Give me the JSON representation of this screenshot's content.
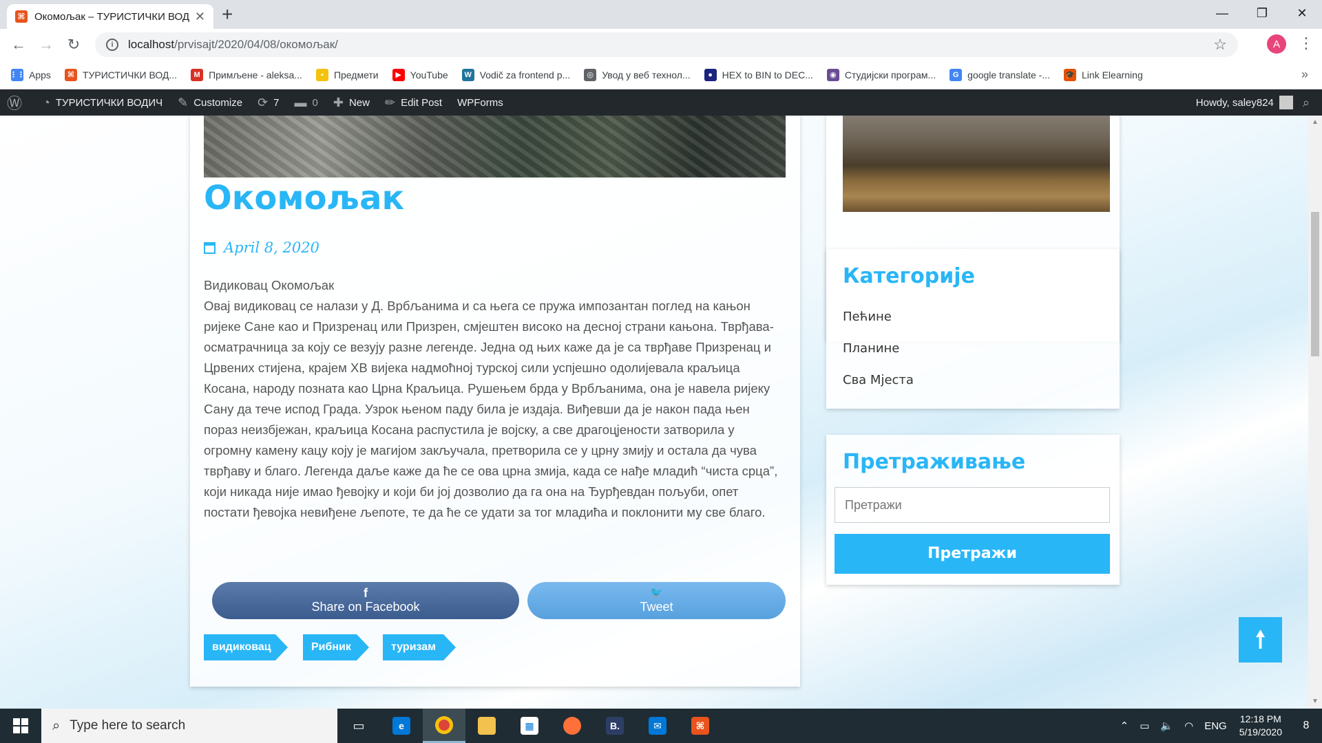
{
  "browser": {
    "tab_title": "Окомољак – ТУРИСТИЧКИ ВОДИ",
    "tab_favicon": "⌘",
    "url_host": "localhost",
    "url_path": "/prvisajt/2020/04/08/окомољак/",
    "profile_initial": "A"
  },
  "bookmarks": [
    {
      "label": "Apps",
      "color": "#4285f4",
      "glyph": "⋮⋮"
    },
    {
      "label": "ТУРИСТИЧКИ ВОД...",
      "color": "#e8531e",
      "glyph": "⌘"
    },
    {
      "label": "Примљене - aleksa...",
      "color": "#d93025",
      "glyph": "M"
    },
    {
      "label": "Предмети",
      "color": "#f4c20d",
      "glyph": "▪"
    },
    {
      "label": "YouTube",
      "color": "#ff0000",
      "glyph": "▶"
    },
    {
      "label": "Vodič za frontend p...",
      "color": "#21759b",
      "glyph": "W"
    },
    {
      "label": "Увод у веб технол...",
      "color": "#5f6368",
      "glyph": "◎"
    },
    {
      "label": "HEX to BIN to DEC...",
      "color": "#1a237e",
      "glyph": "●"
    },
    {
      "label": "Студијски програм...",
      "color": "#6a4c93",
      "glyph": "◉"
    },
    {
      "label": "google translate -...",
      "color": "#4285f4",
      "glyph": "G"
    },
    {
      "label": "Link Elearning",
      "color": "#e65100",
      "glyph": "🎓"
    }
  ],
  "admin_bar": {
    "site_name": "ТУРИСТИЧКИ ВОДИЧ",
    "customize": "Customize",
    "updates": "7",
    "comments": "0",
    "new": "New",
    "edit_post": "Edit Post",
    "wpforms": "WPForms",
    "howdy": "Howdy, saley824"
  },
  "post": {
    "title": "Окомољак",
    "date": "April 8, 2020",
    "body_heading": "Видиковац Окомољак",
    "body": "Овај видиковац се налази у Д. Врбљанима и са њега се пружа импозантан поглед на кањон ријеке Сане као и Призренац или Призрен, смјештен високо на десној страни кањона. Тврђава-осматрачница за коју се везују разне легенде. Једна од њих каже да је са тврђаве Призренац и Црвених стијена, крајем XВ вијека надмоћној турској сили успјешно одолијевала краљица Косана, народу позната као Црна Краљица. Рушењем брда у Врбљанима, она је навела ријеку Сану да тече испод Града. Узрок њеном паду била је издаја. Виђевши да је након пада њен пораз неизбјежан, краљица Косана распустила је војску, а све драгоцјености затворила у огромну камену кацу коју је магијом закључала, претворила се у црну змију и остала да чува тврђаву и благо. Легенда даље каже да ће се ова црна змија, када се нађе младић “чиста срца”, који никада није имао ђевојку и који би јој дозволио да га она на Ђурђевдан пољуби, опет постати ђевојка невиђене љепоте, те да ће се удати за тог младића и поклонити му све благо.",
    "share_facebook": "Share on Facebook",
    "share_facebook_icon": "f",
    "share_twitter": "Tweet",
    "share_twitter_icon": "🐦",
    "tags": [
      "видиковац",
      "Рибник",
      "туризам"
    ]
  },
  "sidebar": {
    "categories_title": "Категорије",
    "categories": [
      "Пећине",
      "Планине",
      "Сва Мјеста"
    ],
    "search_title": "Претраживање",
    "search_placeholder": "Претражи",
    "search_button": "Претражи"
  },
  "back_to_top": "🠕",
  "taskbar": {
    "search_placeholder": "Type here to search",
    "language": "ENG",
    "time": "12:18 PM",
    "date": "5/19/2020",
    "notifications": "8"
  },
  "colors": {
    "accent": "#29b6f6",
    "admin_bar": "#23282d",
    "facebook": "#3b5c8e",
    "twitter": "#57a1de"
  }
}
